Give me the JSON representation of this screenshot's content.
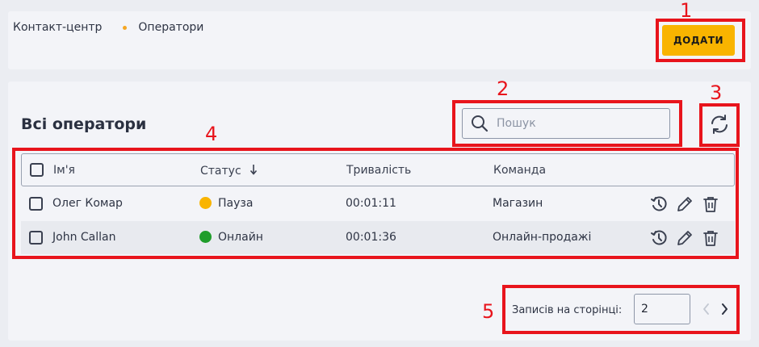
{
  "header": {
    "breadcrumb": [
      "Контакт-центр",
      "Оператори"
    ],
    "add_label": "ДОДАТИ"
  },
  "main": {
    "title": "Всі оператори",
    "search_placeholder": "Пошук"
  },
  "table": {
    "columns": [
      "Ім'я",
      "Статус",
      "Тривалість",
      "Команда"
    ],
    "rows": [
      {
        "name": "Олег Комар",
        "status": "Пауза",
        "status_color": "#f9b400",
        "duration": "00:01:11",
        "team": "Магазин"
      },
      {
        "name": "John Callan",
        "status": "Онлайн",
        "status_color": "#1f9d2b",
        "duration": "00:01:36",
        "team": "Онлайн-продажі"
      }
    ]
  },
  "pagination": {
    "label": "Записів на сторінці:",
    "per_page": "2"
  },
  "annotations": [
    "1",
    "2",
    "3",
    "4",
    "5"
  ],
  "colors": {
    "accent": "#f9b400",
    "annotation": "#e8141c"
  }
}
